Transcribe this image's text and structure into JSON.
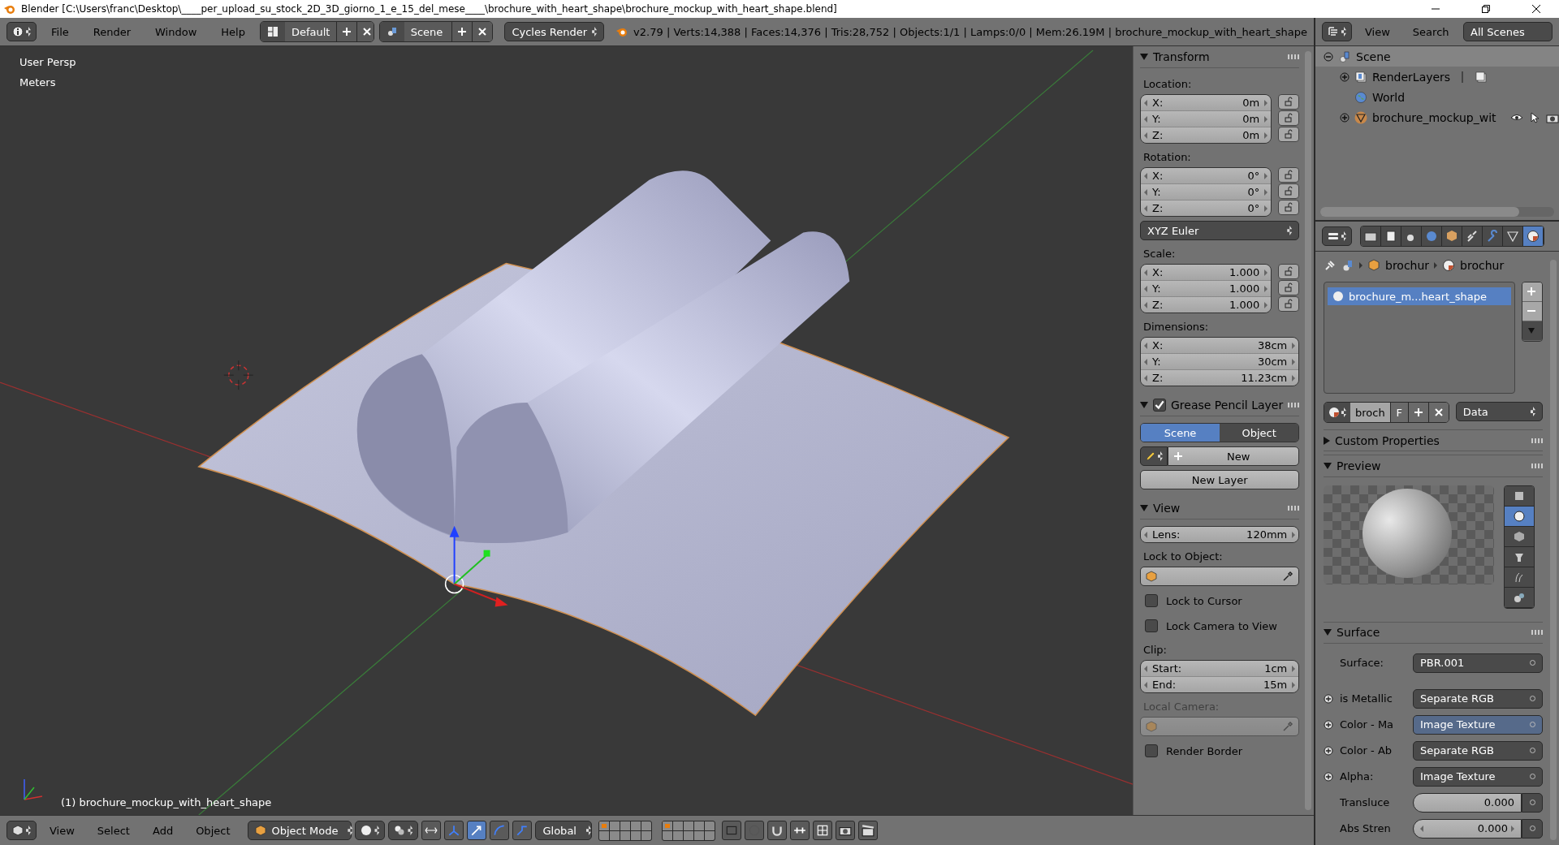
{
  "title_bar": {
    "title": "Blender [C:\\Users\\franc\\Desktop\\____per_upload_su_stock_2D_3D_giorno_1_e_15_del_mese____\\brochure_with_heart_shape\\brochure_mockup_with_heart_shape.blend]"
  },
  "header": {
    "menus": [
      "File",
      "Render",
      "Window",
      "Help"
    ],
    "layout": "Default",
    "scene": "Scene",
    "engine": "Cycles Render",
    "stats": "v2.79 | Verts:14,388 | Faces:14,376 | Tris:28,752 | Objects:1/1 | Lamps:0/0 | Mem:26.19M | brochure_mockup_with_heart_shape"
  },
  "viewport": {
    "view": "User Persp",
    "units": "Meters",
    "active_object": "(1) brochure_mockup_with_heart_shape"
  },
  "n_panel": {
    "sections": [
      {
        "title": "Transform",
        "expanded": true,
        "rows": [
          {
            "kind": "label",
            "text": "Location:"
          },
          {
            "kind": "vector",
            "locks": true,
            "fields": [
              {
                "axis": "X:",
                "value": "0m"
              },
              {
                "axis": "Y:",
                "value": "0m"
              },
              {
                "axis": "Z:",
                "value": "0m"
              }
            ]
          },
          {
            "kind": "label",
            "text": "Rotation:"
          },
          {
            "kind": "vector",
            "locks": true,
            "fields": [
              {
                "axis": "X:",
                "value": "0°"
              },
              {
                "axis": "Y:",
                "value": "0°"
              },
              {
                "axis": "Z:",
                "value": "0°"
              }
            ]
          },
          {
            "kind": "dropdown",
            "text": "XYZ Euler"
          },
          {
            "kind": "label",
            "text": "Scale:"
          },
          {
            "kind": "vector",
            "locks": true,
            "fields": [
              {
                "axis": "X:",
                "value": "1.000"
              },
              {
                "axis": "Y:",
                "value": "1.000"
              },
              {
                "axis": "Z:",
                "value": "1.000"
              }
            ]
          },
          {
            "kind": "label",
            "text": "Dimensions:"
          },
          {
            "kind": "vector",
            "locks": false,
            "fields": [
              {
                "axis": "X:",
                "value": "38cm"
              },
              {
                "axis": "Y:",
                "value": "30cm"
              },
              {
                "axis": "Z:",
                "value": "11.23cm"
              }
            ]
          }
        ]
      },
      {
        "title": "Grease Pencil Layer",
        "expanded": true,
        "checked": true,
        "rows": [
          {
            "kind": "tabs",
            "tabs": [
              {
                "label": "Scene",
                "selected": true
              },
              {
                "label": "Object",
                "selected": false
              }
            ]
          },
          {
            "kind": "new",
            "text": "New"
          },
          {
            "kind": "button",
            "text": "New Layer"
          }
        ]
      },
      {
        "title": "View",
        "expanded": true,
        "rows": [
          {
            "kind": "vector",
            "locks": false,
            "fields": [
              {
                "axis": "Lens:",
                "value": "120mm"
              }
            ]
          },
          {
            "kind": "label",
            "text": "Lock to Object:"
          },
          {
            "kind": "object",
            "disabled": false
          },
          {
            "kind": "checkbox",
            "text": "Lock to Cursor",
            "checked": false
          },
          {
            "kind": "checkbox",
            "text": "Lock Camera to View",
            "checked": false
          },
          {
            "kind": "label",
            "text": "Clip:"
          },
          {
            "kind": "vector",
            "locks": false,
            "fields": [
              {
                "axis": "Start:",
                "value": "1cm"
              },
              {
                "axis": "End:",
                "value": "15m"
              }
            ]
          },
          {
            "kind": "label",
            "text": "Local Camera:",
            "disabled": true
          },
          {
            "kind": "object",
            "disabled": true
          },
          {
            "kind": "checkbox",
            "text": "Render Border",
            "checked": false
          }
        ]
      }
    ]
  },
  "outliner": {
    "menus": [
      "View",
      "Search"
    ],
    "filter": "All Scenes",
    "tree": [
      {
        "label": "Scene",
        "kind": "scene",
        "expanded": true,
        "children": [
          {
            "label": "RenderLayers",
            "kind": "render_layers",
            "expanded": false
          },
          {
            "label": "World",
            "kind": "world"
          },
          {
            "label": "brochure_mockup_wit",
            "kind": "mesh_object",
            "expanded": false
          }
        ]
      }
    ]
  },
  "properties": {
    "tabs": [
      {
        "kind": "render",
        "selected": false
      },
      {
        "kind": "render_layers",
        "selected": false
      },
      {
        "kind": "scene",
        "selected": false
      },
      {
        "kind": "world",
        "selected": false
      },
      {
        "kind": "object",
        "selected": false
      },
      {
        "kind": "constraints",
        "selected": false
      },
      {
        "kind": "modifiers",
        "selected": false
      },
      {
        "kind": "data",
        "selected": false
      },
      {
        "kind": "material",
        "selected": true
      }
    ],
    "breadcrumb": [
      "brochur",
      "brochur"
    ],
    "material_slots": [
      {
        "name": "brochure_m...heart_shape",
        "selected": true
      }
    ],
    "material_selector": {
      "name": "broch",
      "fake_user": "F",
      "link": "Data"
    },
    "panels": [
      {
        "title": "Custom Properties",
        "expanded": false
      },
      {
        "title": "Preview",
        "kind": "preview",
        "expanded": true,
        "shapes": [
          {
            "kind": "plane",
            "selected": false
          },
          {
            "kind": "sphere",
            "selected": true
          },
          {
            "kind": "cube",
            "selected": false
          },
          {
            "kind": "monkey",
            "selected": false
          },
          {
            "kind": "hair",
            "selected": false
          },
          {
            "kind": "sphere_group",
            "selected": false
          }
        ]
      },
      {
        "title": "Surface",
        "kind": "surface",
        "expanded": true,
        "rows": [
          {
            "kind": "link",
            "label": "Surface:",
            "value": "PBR.001",
            "expandable": false,
            "highlighted": false
          },
          {
            "kind": "link",
            "label": "is Metallic",
            "value": "Separate RGB",
            "expandable": true,
            "highlighted": false
          },
          {
            "kind": "link",
            "label": "Color - Ma",
            "value": "Image Texture",
            "expandable": true,
            "highlighted": true
          },
          {
            "kind": "link",
            "label": "Color - Ab",
            "value": "Separate RGB",
            "expandable": true,
            "highlighted": false
          },
          {
            "kind": "link",
            "label": "Alpha:",
            "value": "Image Texture",
            "expandable": true,
            "highlighted": false
          },
          {
            "kind": "slider",
            "label": "Transluce",
            "value": "0.000",
            "level": 0,
            "expandable": false
          },
          {
            "kind": "number",
            "label": "Abs Stren",
            "value": "0.000",
            "expandable": false
          }
        ]
      }
    ]
  },
  "bottom_header": {
    "menus": [
      "View",
      "Select",
      "Add",
      "Object"
    ],
    "mode": "Object Mode",
    "orientation": "Global"
  }
}
